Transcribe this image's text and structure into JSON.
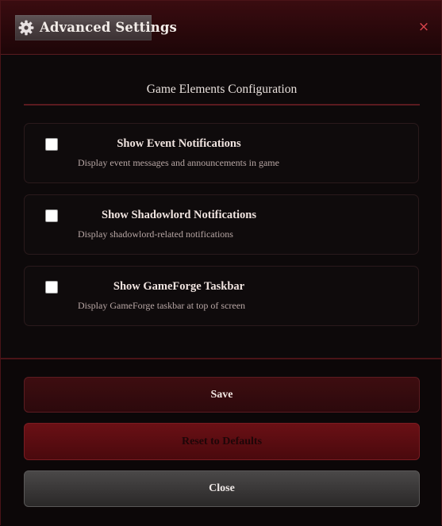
{
  "dialog": {
    "title": "Advanced Settings",
    "title_icon": "gear-icon",
    "close_glyph": "×",
    "accent_color": "#d9444c"
  },
  "section": {
    "title": "Game Elements Configuration"
  },
  "options": [
    {
      "label": "Show Event Notifications",
      "description": "Display event messages and announcements in game",
      "checked": false
    },
    {
      "label": "Show Shadowlord Notifications",
      "description": "Display shadowlord-related notifications",
      "checked": false
    },
    {
      "label": "Show GameForge Taskbar",
      "description": "Display GameForge taskbar at top of screen",
      "checked": false
    }
  ],
  "buttons": {
    "save": "Save",
    "reset": "Reset to Defaults",
    "close": "Close"
  }
}
